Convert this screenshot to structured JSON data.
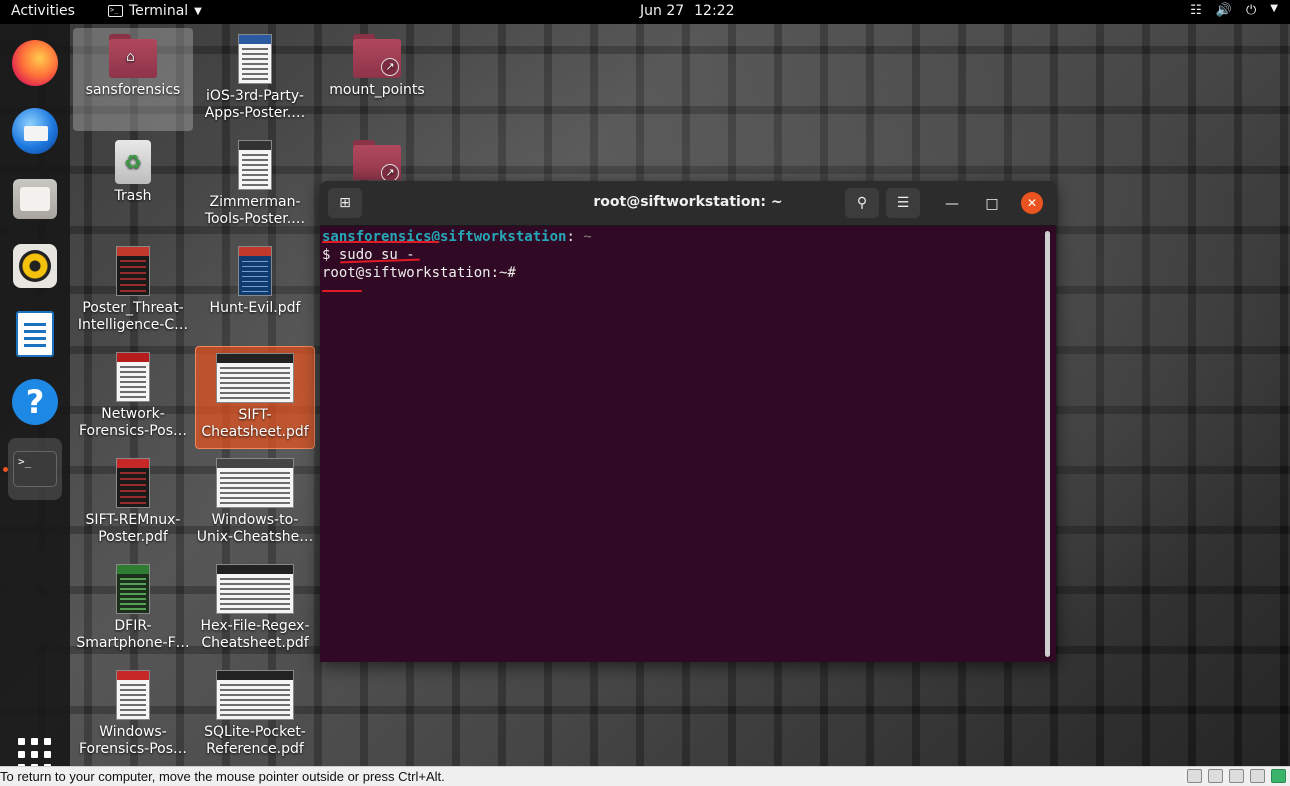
{
  "topbar": {
    "activities": "Activities",
    "app_name": "Terminal",
    "date": "Jun 27",
    "time": "12:22",
    "tray_icons": [
      "network-icon",
      "volume-icon",
      "power-icon",
      "chevron-down-icon"
    ]
  },
  "dock": {
    "items": [
      {
        "name": "firefox-icon"
      },
      {
        "name": "thunderbird-icon"
      },
      {
        "name": "files-icon"
      },
      {
        "name": "rhythmbox-icon"
      },
      {
        "name": "libreoffice-writer-icon"
      },
      {
        "name": "help-icon",
        "glyph": "?"
      },
      {
        "name": "terminal-icon",
        "glyph": ">_"
      }
    ],
    "show_apps": "show-applications-icon"
  },
  "desktop": {
    "icons": [
      {
        "label": "sansforensics",
        "type": "home-folder"
      },
      {
        "label": "iOS-3rd-Party-\nApps-Poster.…",
        "type": "pdf"
      },
      {
        "label": "mount_points",
        "type": "folder-link"
      },
      {
        "label": "Trash",
        "type": "trash"
      },
      {
        "label": "Zimmerman-\nTools-Poster.…",
        "type": "pdf"
      },
      {
        "label": "Poster_Threat-\nIntelligence-C…",
        "type": "pdf"
      },
      {
        "label": "Hunt-Evil.pdf",
        "type": "pdf"
      },
      {
        "label": "Network-\nForensics-Pos…",
        "type": "pdf"
      },
      {
        "label": "SIFT-\nCheatsheet.pdf",
        "type": "pdf"
      },
      {
        "label": "SIFT-REMnux-\nPoster.pdf",
        "type": "pdf"
      },
      {
        "label": "Windows-to-\nUnix-Cheatshe…",
        "type": "pdf"
      },
      {
        "label": "DFIR-\nSmartphone-F…",
        "type": "pdf"
      },
      {
        "label": "Hex-File-Regex-\nCheatsheet.pdf",
        "type": "pdf"
      },
      {
        "label": "Windows-\nForensics-Pos…",
        "type": "pdf"
      },
      {
        "label": "SQLite-Pocket-\nReference.pdf",
        "type": "pdf"
      }
    ]
  },
  "terminal": {
    "title": "root@siftworkstation: ~",
    "lines": [
      {
        "user": "sansforensics@siftworkstation",
        "sep": ":",
        "path": " ~"
      },
      {
        "text": "$ sudo su -"
      },
      {
        "text": "root@siftworkstation:~#"
      }
    ]
  },
  "statusbar": {
    "message": "To return to your computer, move the mouse pointer outside or press Ctrl+Alt."
  },
  "colors": {
    "terminal_bg": "#300a24",
    "accent": "#e95420",
    "prompt_user": "#26a7b8",
    "annotation_ink": "#e01b24"
  }
}
